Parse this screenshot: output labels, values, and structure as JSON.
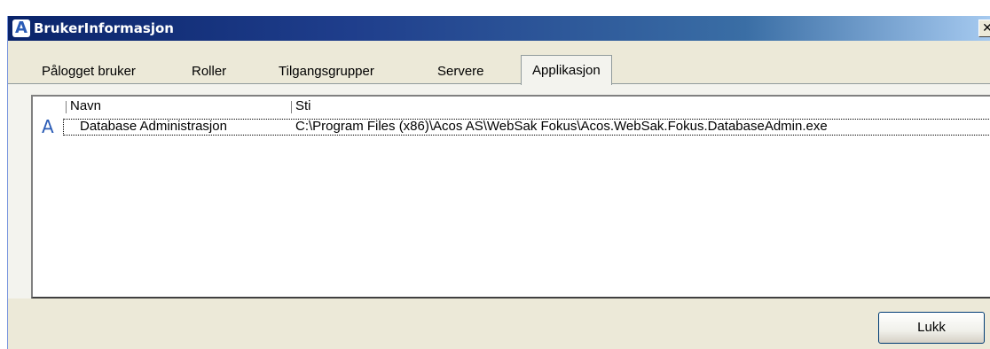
{
  "window": {
    "title": "BrukerInformasjon",
    "logo_letter": "A",
    "close_glyph": "✕"
  },
  "tabs": [
    {
      "label": "Pålogget bruker",
      "active": false
    },
    {
      "label": "Roller",
      "active": false
    },
    {
      "label": "Tilgangsgrupper",
      "active": false
    },
    {
      "label": "Servere",
      "active": false
    },
    {
      "label": "Applikasjon",
      "active": true
    }
  ],
  "list": {
    "columns": [
      "Navn",
      "Sti"
    ],
    "rows": [
      {
        "icon": "acos-app-icon",
        "icon_glyph": "A",
        "navn": "Database Administrasjon",
        "sti": "C:\\Program Files (x86)\\Acos AS\\WebSak Fokus\\Acos.WebSak.Fokus.DatabaseAdmin.exe"
      }
    ]
  },
  "buttons": {
    "close_label": "Lukk"
  },
  "colors": {
    "titlebar": "#0a246a",
    "face": "#ece9d8",
    "accent_icon": "#2b5cb6"
  }
}
